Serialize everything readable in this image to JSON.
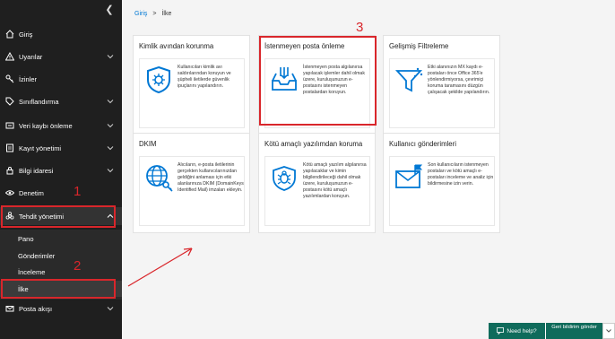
{
  "breadcrumb": {
    "home": "Giriş",
    "separator": ">",
    "current": "İlke"
  },
  "sidebar": {
    "items": [
      {
        "label": "Giriş"
      },
      {
        "label": "Uyarılar"
      },
      {
        "label": "İzinler"
      },
      {
        "label": "Sınıflandırma"
      },
      {
        "label": "Veri kaybı önleme"
      },
      {
        "label": "Kayıt yönetimi"
      },
      {
        "label": "Bilgi idaresi"
      },
      {
        "label": "Denetim"
      },
      {
        "label": "Tehdit yönetimi"
      },
      {
        "label": "Posta akışı"
      }
    ],
    "subitems": [
      {
        "label": "Pano"
      },
      {
        "label": "Gönderimler"
      },
      {
        "label": "İnceleme"
      },
      {
        "label": "İlke"
      }
    ]
  },
  "cards": [
    {
      "title": "Kimlik avından korunma",
      "desc": "Kullanıcıları kimlik avı saldırılarından koruyun ve şüpheli iletilerde güvenlik ipuçlarını yapılandırın.",
      "icon": "shield-icon"
    },
    {
      "title": "İstenmeyen posta önleme",
      "desc": "İstenmeyen posta algılanırsa yapılacak işlemler dahil olmak üzere, kuruluşunuzun e-postasını istenmeyen postalardan koruyun.",
      "icon": "inbox-icon"
    },
    {
      "title": "Gelişmiş Filtreleme",
      "desc": "Etki alanınızın MX kaydı e-postaları önce Office 365'e yönlendirmiyorsa, çevrimiçi koruma taramasını düzgün çalışacak şekilde yapılandırın.",
      "icon": "filter-icon"
    },
    {
      "title": "DKIM",
      "desc": "Alıcıların, e-posta iletilerinin gerçekten kullanıcılarınızdan geldiğini anlaması için etki alanlarınıza DKIM (DomainKeys Identified Mail) imzaları ekleyin.",
      "icon": "globe-icon"
    },
    {
      "title": "Kötü amaçlı yazılımdan koruma",
      "desc": "Kötü amaçlı yazılım algılanırsa yapılacaklar ve kimin bilgilendirileceği dahil olmak üzere, kuruluşunuzun e-postasını kötü amaçlı yazılımlardan koruyun.",
      "icon": "bug-icon"
    },
    {
      "title": "Kullanıcı gönderimleri",
      "desc": "Son kullanıcıların istenmeyen postaları ve kötü amaçlı e-postaları inceleme ve analiz için bildirmesine izin verin.",
      "icon": "mail-flag-icon"
    }
  ],
  "annotations": {
    "n1": "1",
    "n2": "2",
    "n3": "3"
  },
  "help": {
    "need_help": "Need help?",
    "feedback": "Geri bildirim gönder"
  },
  "colors": {
    "sidebar": "#1f1f1f",
    "accent": "#0078d4",
    "highlight": "#d9262b",
    "help": "#0f6b5b"
  }
}
